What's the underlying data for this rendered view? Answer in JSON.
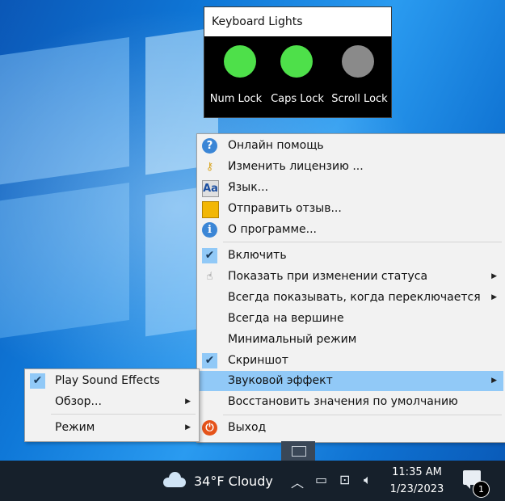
{
  "keyboard_lights": {
    "title": "Keyboard Lights",
    "lights": [
      {
        "label": "Num Lock",
        "state": "on",
        "color": "#4ee04a"
      },
      {
        "label": "Caps Lock",
        "state": "on",
        "color": "#4ee04a"
      },
      {
        "label": "Scroll Lock",
        "state": "off",
        "color": "#8a8a8a"
      }
    ]
  },
  "context_menu": {
    "items": [
      {
        "label": "Онлайн помощь",
        "icon": "help-icon"
      },
      {
        "label": "Изменить лицензию ...",
        "icon": "key-icon"
      },
      {
        "label": "Язык...",
        "icon": "language-icon"
      },
      {
        "label": "Отправить отзыв...",
        "icon": "feedback-icon"
      },
      {
        "label": "О программе...",
        "icon": "info-icon"
      },
      {
        "label": "Включить",
        "icon": "checkmark-icon",
        "checked": true
      },
      {
        "label": "Показать при изменении статуса",
        "icon": "hand-pointer-icon",
        "submenu": true
      },
      {
        "label": "Всегда показывать, когда переключается",
        "submenu": true
      },
      {
        "label": "Всегда на вершине"
      },
      {
        "label": "Минимальный режим"
      },
      {
        "label": "Скриншот",
        "icon": "checkmark-icon",
        "checked": true
      },
      {
        "label": "Звуковой эффект",
        "submenu": true,
        "highlighted": true
      },
      {
        "label": "Восстановить значения по умолчанию"
      },
      {
        "label": "Выход",
        "icon": "exit-icon"
      }
    ]
  },
  "sound_submenu": {
    "items": [
      {
        "label": "Play Sound Effects",
        "checked": true
      },
      {
        "label": "Обзор...",
        "submenu": true
      },
      {
        "label": "Режим",
        "submenu": true
      }
    ]
  },
  "taskbar": {
    "weather": "34°F  Cloudy",
    "time": "11:35 AM",
    "date": "1/23/2023",
    "notification_count": "1"
  },
  "colors": {
    "highlight": "#91c9f7",
    "led_on": "#4ee04a",
    "led_off": "#8a8a8a",
    "taskbar": "#16202b"
  }
}
